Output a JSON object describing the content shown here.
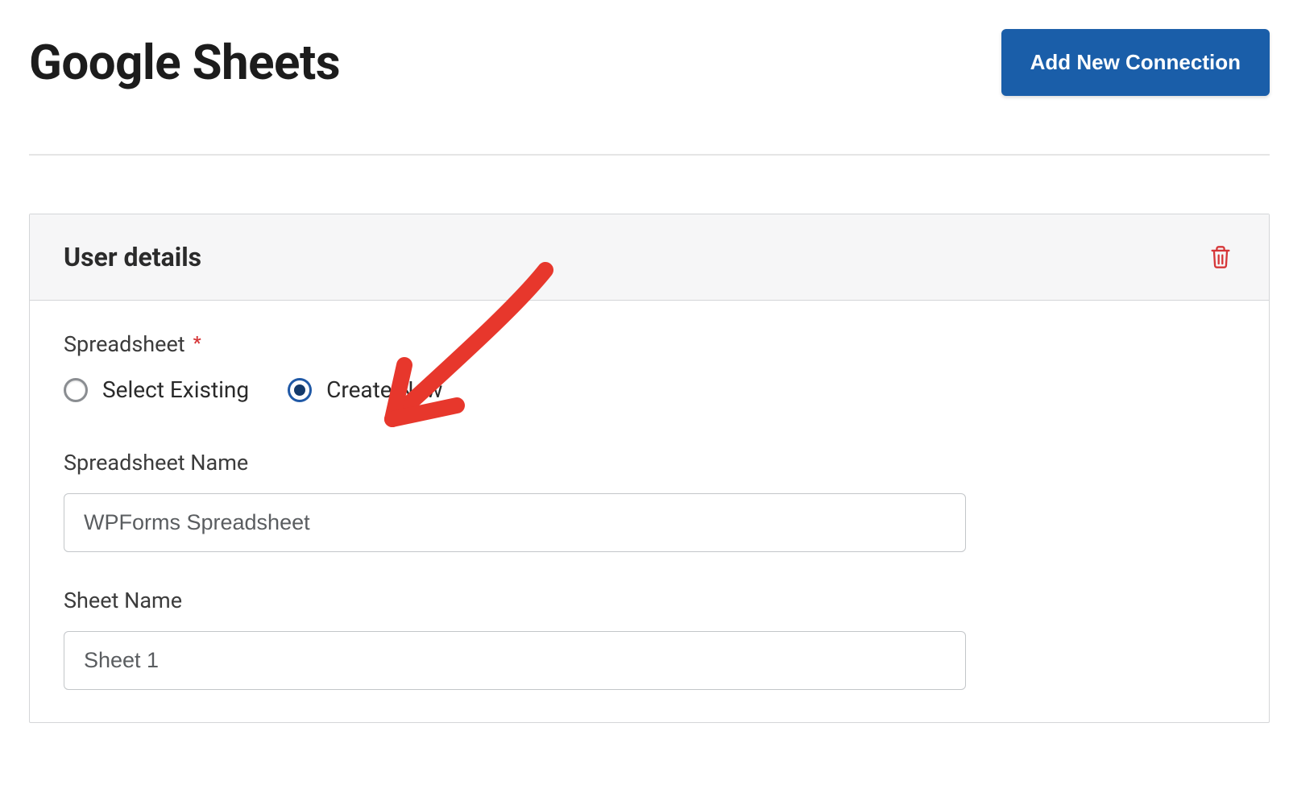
{
  "header": {
    "title": "Google Sheets",
    "add_connection_label": "Add New Connection"
  },
  "panel": {
    "title": "User details",
    "delete_icon": "trash-icon"
  },
  "form": {
    "spreadsheet_label": "Spreadsheet",
    "required_marker": "*",
    "radio_existing_label": "Select Existing",
    "radio_new_label": "Create New",
    "spreadsheet_name_label": "Spreadsheet Name",
    "spreadsheet_name_value": "WPForms Spreadsheet",
    "sheet_name_label": "Sheet Name",
    "sheet_name_value": "Sheet 1"
  },
  "annotation": {
    "arrow_icon": "hand-drawn-arrow"
  }
}
